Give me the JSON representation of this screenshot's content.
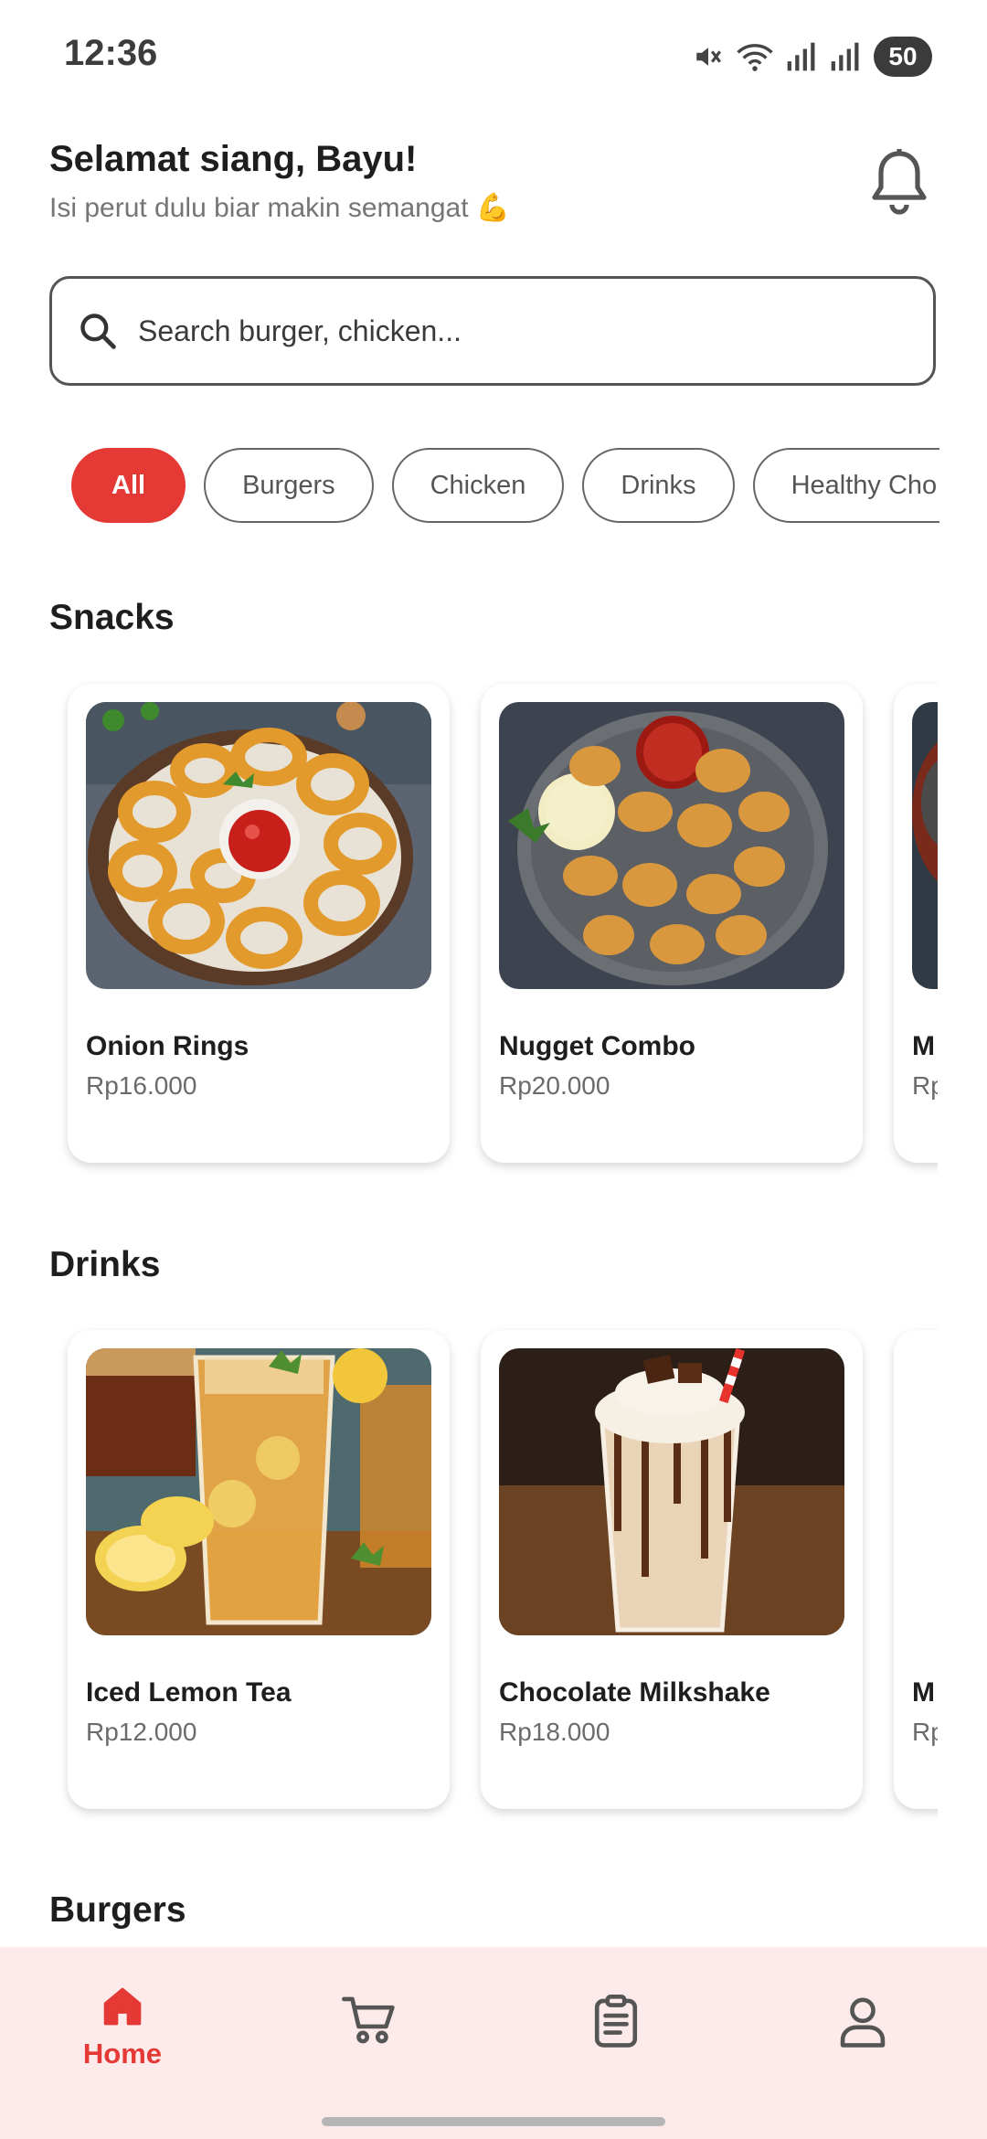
{
  "status_bar": {
    "time": "12:36",
    "battery": "50",
    "icons": [
      "mute-icon",
      "wifi-icon",
      "signal-icon",
      "signal-icon",
      "battery-icon"
    ]
  },
  "header": {
    "greeting": "Selamat siang, Bayu!",
    "subtitle": "Isi perut dulu biar makin semangat 💪",
    "notification_icon": "bell-icon"
  },
  "search": {
    "placeholder": "Search burger, chicken..."
  },
  "categories": [
    {
      "label": "All",
      "active": true
    },
    {
      "label": "Burgers",
      "active": false
    },
    {
      "label": "Chicken",
      "active": false
    },
    {
      "label": "Drinks",
      "active": false
    },
    {
      "label": "Healthy Cho",
      "active": false
    }
  ],
  "sections": [
    {
      "title": "Snacks",
      "items": [
        {
          "name": "Onion Rings",
          "price": "Rp16.000"
        },
        {
          "name": "Nugget Combo",
          "price": "Rp20.000"
        },
        {
          "name": "M",
          "price": "Rp"
        }
      ]
    },
    {
      "title": "Drinks",
      "items": [
        {
          "name": "Iced Lemon Tea",
          "price": "Rp12.000"
        },
        {
          "name": "Chocolate Milkshake",
          "price": "Rp18.000"
        },
        {
          "name": "M",
          "price": "Rp"
        }
      ]
    },
    {
      "title": "Burgers",
      "items": []
    }
  ],
  "bottom_nav": {
    "items": [
      {
        "label": "Home",
        "icon": "home-icon",
        "active": true
      },
      {
        "label": "",
        "icon": "cart-icon",
        "active": false
      },
      {
        "label": "",
        "icon": "orders-icon",
        "active": false
      },
      {
        "label": "",
        "icon": "profile-icon",
        "active": false
      }
    ]
  },
  "colors": {
    "accent": "#e53935",
    "nav_background": "#fdeaea",
    "text_primary": "#1e1e1e",
    "text_secondary": "#757575"
  }
}
